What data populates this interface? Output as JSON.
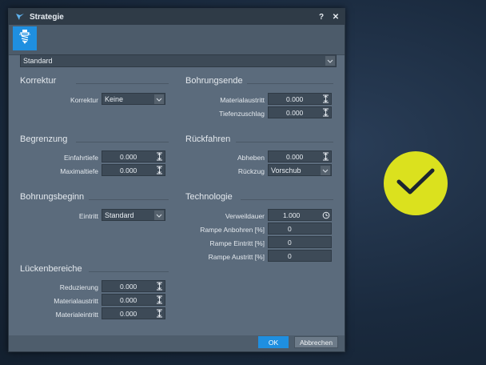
{
  "window": {
    "title": "Strategie",
    "help_label": "?",
    "close_label": "✕"
  },
  "toolbar": {
    "tool_icon": "drill-bit-icon"
  },
  "strategy_select": {
    "value": "Standard"
  },
  "sections": {
    "korrektur": {
      "title": "Korrektur",
      "korrektur": {
        "label": "Korrektur",
        "value": "Keine"
      }
    },
    "begrenzung": {
      "title": "Begrenzung",
      "einfahrtiefe": {
        "label": "Einfahrtiefe",
        "value": "0.000"
      },
      "maximaltiefe": {
        "label": "Maximaltiefe",
        "value": "0.000"
      }
    },
    "bohrungsbeginn": {
      "title": "Bohrungsbeginn",
      "eintritt": {
        "label": "Eintritt",
        "value": "Standard"
      }
    },
    "lueckenbereiche": {
      "title": "Lückenbereiche",
      "reduzierung": {
        "label": "Reduzierung",
        "value": "0.000"
      },
      "materialaustritt": {
        "label": "Materialaustritt",
        "value": "0.000"
      },
      "materialeintritt": {
        "label": "Materialeintritt",
        "value": "0.000"
      }
    },
    "bohrungsende": {
      "title": "Bohrungsende",
      "materialaustritt": {
        "label": "Materialaustritt",
        "value": "0.000"
      },
      "tiefenzuschlag": {
        "label": "Tiefenzuschlag",
        "value": "0.000"
      }
    },
    "rueckfahren": {
      "title": "Rückfahren",
      "abheben": {
        "label": "Abheben",
        "value": "0.000"
      },
      "rueckzug": {
        "label": "Rückzug",
        "value": "Vorschub"
      }
    },
    "technologie": {
      "title": "Technologie",
      "verweildauer": {
        "label": "Verweildauer",
        "value": "1.000"
      },
      "rampe_anbohren": {
        "label": "Rampe Anbohren [%]",
        "value": "0"
      },
      "rampe_eintritt": {
        "label": "Rampe Eintritt [%]",
        "value": "0"
      },
      "rampe_austritt": {
        "label": "Rampe Austritt [%]",
        "value": "0"
      }
    }
  },
  "buttons": {
    "ok": "OK",
    "cancel": "Abbrechen"
  },
  "colors": {
    "accent": "#1f8fe0",
    "badge": "#dbe11e",
    "dialog_bg": "#5b6b7c",
    "titlebar_bg": "#2f3b47"
  }
}
